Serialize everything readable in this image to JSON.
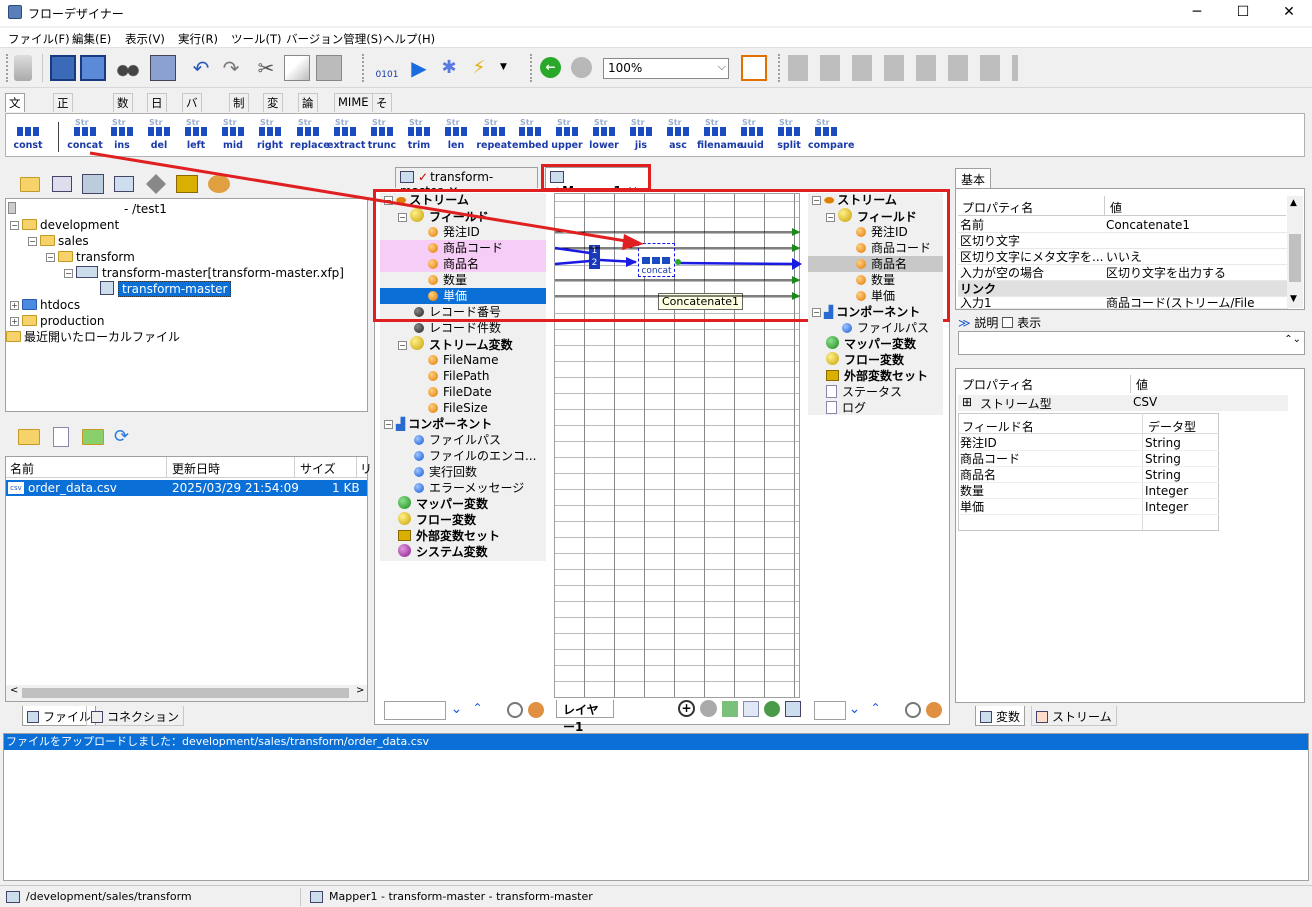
{
  "window": {
    "title": "フローデザイナー",
    "min": "─",
    "max": "☐",
    "close": "✕"
  },
  "menu": [
    "ファイル(F)",
    "編集(E)",
    "表示(V)",
    "実行(R)",
    "ツール(T)",
    "バージョン管理(S)",
    "ヘルプ(H)"
  ],
  "toolbar": {
    "zoom": "100%"
  },
  "categories": [
    "文字列",
    "正規表現",
    "数値",
    "日付",
    "バイナリ",
    "制御",
    "変換",
    "論理",
    "MIME",
    "その他"
  ],
  "functions": [
    "const",
    "concat",
    "ins",
    "del",
    "left",
    "mid",
    "right",
    "replace",
    "extract",
    "trunc",
    "trim",
    "len",
    "repeat",
    "embed",
    "upper",
    "lower",
    "jis",
    "asc",
    "filename",
    "uuid",
    "split",
    "compare"
  ],
  "fn_icon_prefix": "Str",
  "project_tree": {
    "root": "- /test1",
    "development": "development",
    "sales": "sales",
    "transform": "transform",
    "xfp": "transform-master[transform-master.xfp]",
    "flow": "transform-master",
    "htdocs": "htdocs",
    "production": "production",
    "recent": "最近開いたローカルファイル"
  },
  "file_list": {
    "headers": [
      "名前",
      "更新日時",
      "サイズ",
      "リ"
    ],
    "rows": [
      {
        "name": "order_data.csv",
        "date": "2025/03/29 21:54:09",
        "size": "1 KB",
        "icon": "csv"
      }
    ]
  },
  "left_tabs": [
    "ファイル",
    "コネクション"
  ],
  "editor_tabs": [
    "transform-master",
    "Mapper1"
  ],
  "mapper_left": {
    "stream": "ストリーム",
    "field": "フィールド",
    "fields": [
      "発注ID",
      "商品コード",
      "商品名",
      "数量",
      "単価"
    ],
    "record_no": "レコード番号",
    "record_count": "レコード件数",
    "stream_vars": "ストリーム変数",
    "svars": [
      "FileName",
      "FilePath",
      "FileDate",
      "FileSize"
    ],
    "component": "コンポーネント",
    "comps": [
      "ファイルパス",
      "ファイルのエンコ...",
      "実行回数",
      "エラーメッセージ"
    ],
    "mapper_var": "マッパー変数",
    "flow_var": "フロー変数",
    "ext_var": "外部変数セット",
    "sys_var": "システム変数"
  },
  "mapper_right": {
    "stream": "ストリーム",
    "field": "フィールド",
    "fields": [
      "発注ID",
      "商品コード",
      "商品名",
      "数量",
      "単価"
    ],
    "component": "コンポーネント",
    "file_path": "ファイルパス",
    "mapper_var": "マッパー変数",
    "flow_var": "フロー変数",
    "ext_var": "外部変数セット",
    "status": "ステータス",
    "log": "ログ"
  },
  "mapper_center": {
    "node_label": "concat",
    "tooltip": "Concatenate1",
    "layer_tab": "レイヤー1",
    "inputs": [
      "1",
      "2"
    ]
  },
  "props": {
    "tab": "基本",
    "headers": [
      "プロパティ名",
      "値"
    ],
    "rows": [
      [
        "名前",
        "Concatenate1"
      ],
      [
        "区切り文字",
        ""
      ],
      [
        "区切り文字にメタ文字を...",
        "いいえ"
      ],
      [
        "入力が空の場合",
        "区切り文字を出力する"
      ]
    ],
    "section": "リンク",
    "link_row": [
      "入力1",
      "商品コード(ストリーム/File"
    ],
    "desc_label": "説明",
    "desc_check": "表示"
  },
  "stream_props": {
    "headers": [
      "プロパティ名",
      "値"
    ],
    "type_row": [
      "ストリーム型",
      "CSV"
    ],
    "field_headers": [
      "フィールド名",
      "データ型"
    ],
    "fields": [
      [
        "発注ID",
        "String"
      ],
      [
        "商品コード",
        "String"
      ],
      [
        "商品名",
        "String"
      ],
      [
        "数量",
        "Integer"
      ],
      [
        "単価",
        "Integer"
      ]
    ]
  },
  "right_tabs": [
    "変数",
    "ストリーム"
  ],
  "log": {
    "line": "ファイルをアップロードしました：development/sales/transform/order_data.csv"
  },
  "status": {
    "path": "/development/sales/transform",
    "mapper": "Mapper1 - transform-master - transform-master"
  },
  "colors": {
    "select": "#0a6fd6",
    "pink": "#f6cdf6",
    "red": "#e02020",
    "blue": "#1a1ae0"
  }
}
